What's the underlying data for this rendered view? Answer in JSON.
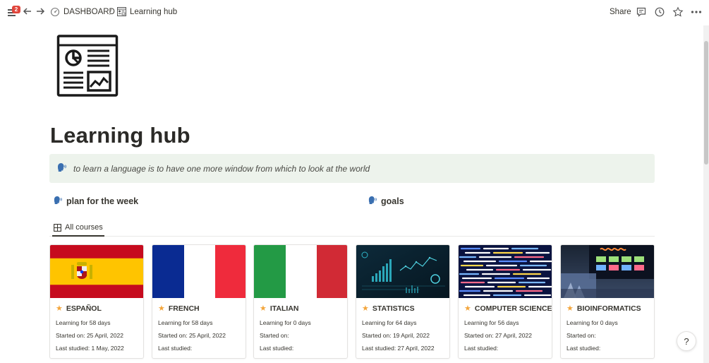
{
  "topbar": {
    "notification_count": "2",
    "breadcrumb_home": "DASHBOARD",
    "breadcrumb_sep": "/",
    "breadcrumb_current": "Learning hub",
    "share_label": "Share"
  },
  "page": {
    "title": "Learning hub",
    "callout": "to learn a language is to have one more window from which to look at the world",
    "links": [
      {
        "label": "plan for the week"
      },
      {
        "label": "goals"
      }
    ],
    "view_tab": "All courses"
  },
  "cards": [
    {
      "title": "ESPAÑOL",
      "learning": "Learning for 58 days",
      "started": "Started on: 25 April, 2022",
      "last": "Last studied: 1 May, 2022",
      "cover": "spain-flag"
    },
    {
      "title": "FRENCH",
      "learning": "Learning for 58 days",
      "started": "Started on: 25 April, 2022",
      "last": "Last studied:",
      "cover": "france-flag"
    },
    {
      "title": "ITALIAN",
      "learning": "Learning for 0 days",
      "started": "Started on:",
      "last": "Last studied:",
      "cover": "italy-flag"
    },
    {
      "title": "STATISTICS",
      "learning": "Learning for 64 days",
      "started": "Started on: 19 April, 2022",
      "last": "Last studied: 27 April, 2022",
      "cover": "data-dashboard"
    },
    {
      "title": "COMPUTER SCIENCE",
      "learning": "Learning for 56 days",
      "started": "Started on: 27 April, 2022",
      "last": "Last studied:",
      "cover": "code-screen"
    },
    {
      "title": "BIOINFORMATICS",
      "learning": "Learning for 0 days",
      "started": "Started on:",
      "last": "Last studied:",
      "cover": "lab-monitor"
    }
  ],
  "help_label": "?",
  "colors": {
    "callout_bg": "#edf3ec",
    "star": "#f3a53b",
    "badge": "#e0463c",
    "text": "#37352f"
  }
}
